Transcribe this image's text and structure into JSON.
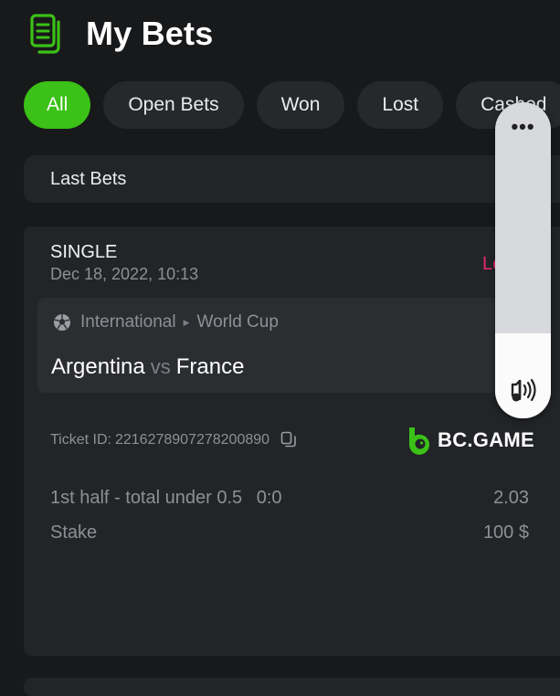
{
  "header": {
    "title": "My Bets"
  },
  "filters": [
    {
      "label": "All",
      "active": true
    },
    {
      "label": "Open Bets",
      "active": false
    },
    {
      "label": "Won",
      "active": false
    },
    {
      "label": "Lost",
      "active": false
    },
    {
      "label": "Cashed",
      "active": false
    }
  ],
  "section": {
    "label": "Last Bets"
  },
  "bet": {
    "type": "SINGLE",
    "date": "Dec 18, 2022, 10:13",
    "status": "Lost",
    "league": "International",
    "tournament": "World Cup",
    "home_team": "Argentina",
    "vs": "vs",
    "away_team": "France",
    "ticket_label": "Ticket ID:",
    "ticket_id": "2216278907278200890",
    "brand": "BC.GAME",
    "market": "1st half - total under 0.5",
    "score": "0:0",
    "odds": "2.03",
    "stake_label": "Stake",
    "stake_value": "100 $"
  },
  "colors": {
    "accent": "#3bc117",
    "lost": "#e8276d",
    "background": "#18191b",
    "card": "#222427"
  },
  "icons": {
    "header": "bets-list-icon",
    "sport": "soccer-ball-icon",
    "copy": "copy-icon",
    "overlay_menu": "more-dots-icon",
    "overlay_sound": "sound-icon"
  }
}
